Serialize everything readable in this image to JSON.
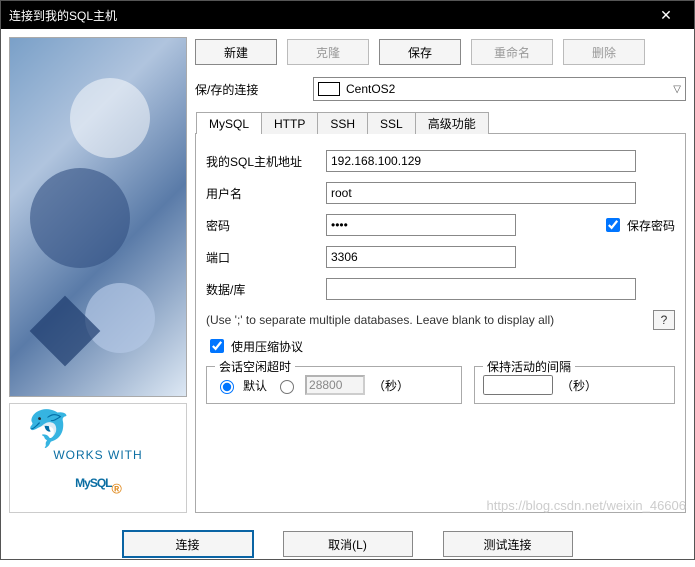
{
  "title": "连接到我的SQL主机",
  "toolbar": {
    "new": "新建",
    "clone": "克隆",
    "save": "保存",
    "rename": "重命名",
    "delete": "删除"
  },
  "saved_label": "保/存的连接",
  "saved_value": "CentOS2",
  "tabs": {
    "mysql": "MySQL",
    "http": "HTTP",
    "ssh": "SSH",
    "ssl": "SSL",
    "adv": "高级功能"
  },
  "fields": {
    "host_label": "我的SQL主机地址",
    "host_value": "192.168.100.129",
    "user_label": "用户名",
    "user_value": "root",
    "pwd_label": "密码",
    "pwd_value": "••••",
    "savepwd_label": "保存密码",
    "port_label": "端口",
    "port_value": "3306",
    "db_label": "数据/库",
    "db_value": ""
  },
  "hint": "(Use ';' to separate multiple databases. Leave blank to display all)",
  "help_btn": "?",
  "compress_label": "使用压缩协议",
  "session": {
    "legend": "会话空闲超时",
    "default_label": "默认",
    "timeout_value": "28800",
    "seconds": "（秒）"
  },
  "keepalive": {
    "legend": "保持活动的间隔",
    "value": "",
    "seconds": "（秒）"
  },
  "footer": {
    "connect": "连接",
    "cancel": "取消(L)",
    "test": "测试连接"
  },
  "logo": {
    "works": "WORKS WITH",
    "mysql": "MySQL",
    "dot": "®"
  },
  "watermark": "https://blog.csdn.net/weixin_46606"
}
